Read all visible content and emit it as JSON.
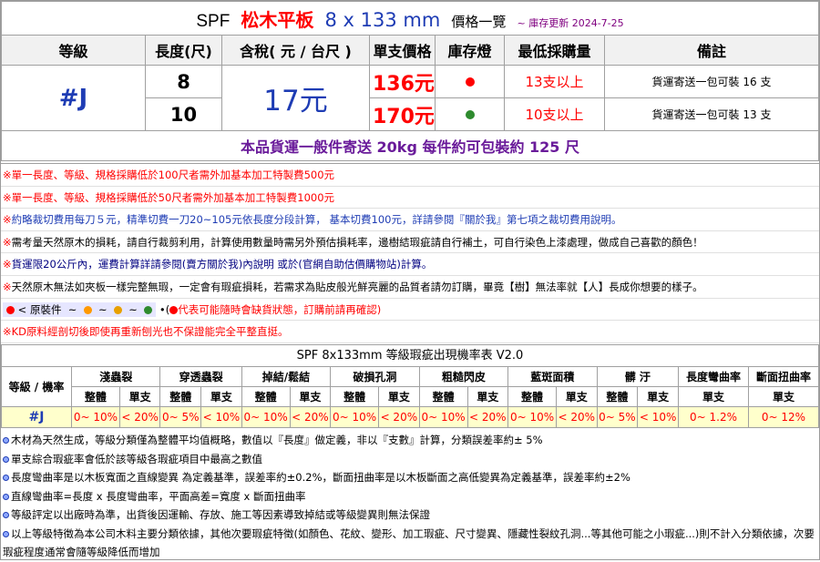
{
  "title": {
    "brand": "SPF",
    "product": "松木平板",
    "spec": "8 x 133 mm",
    "label": "價格一覽",
    "updated": "~ 庫存更新 2024-7-25"
  },
  "headers": {
    "grade": "等級",
    "length": "長度(尺)",
    "tax_price": "含稅( 元 / 台尺 )",
    "unit_price": "單支價格",
    "stock": "庫存燈",
    "min_qty": "最低採購量",
    "remark": "備註"
  },
  "grade": "#J",
  "price_per_ft": "17元",
  "rows": [
    {
      "length": "8",
      "unit_price": "136元",
      "stock_color": "#ff0000",
      "min_qty": "13支以上",
      "remark": "貨運寄送一包可裝 16 支"
    },
    {
      "length": "10",
      "unit_price": "170元",
      "stock_color": "#2e8b2e",
      "min_qty": "10支以上",
      "remark": "貨運寄送一包可裝 13 支"
    }
  ],
  "shipping": "本品貨運一般件寄送 20kg 每件約可包裝約 125 尺",
  "notes": [
    {
      "mark": "※",
      "text": "單一長度、等級、規格採購低於100尺者需外加基本加工特製費500元",
      "color": "red"
    },
    {
      "mark": "※",
      "text": "單一長度、等級、規格採購低於50尺者需外加基本加工特製費1000元",
      "color": "red"
    },
    {
      "mark": "※",
      "text": "約略裁切費用每刀５元，精準切費一刀20~105元依長度分段計算， 基本切費100元，詳請參閱『關於我』第七項之裁切費用說明。",
      "color": "blue"
    },
    {
      "mark": "※",
      "text": "需考量天然原木的損耗，請自行裁剪利用，計算使用數量時需另外預估損耗率，邊樹結瑕疵請自行補土，可自行染色上漆處理，做成自己喜歡的顏色！",
      "color": "black"
    },
    {
      "mark": "※",
      "text": "貨運限20公斤內，運費計算詳請參閱(賣方關於我)內說明 或於(官網自助估價購物站)計算。",
      "color": "navy"
    },
    {
      "mark": "※",
      "text": "天然原木無法如夾板一樣完整無瑕，一定會有瑕疵損耗，若需求為貼皮般光鮮亮麗的品質者請勿訂購，畢竟【樹】無法率就【人】長成你想要的樣子。",
      "color": "black"
    },
    {
      "mark": "※",
      "text": "KD原料經剖切後即使再重新刨光也不保證能完全平整直挺。",
      "color": "red"
    }
  ],
  "legend": {
    "label": "< 原裝件",
    "tilde": "~",
    "dots": [
      "#ff0000",
      "#ff9900",
      "#e8a000",
      "#2e8b2e"
    ],
    "dot_mid": "•",
    "paren_open": "(",
    "warning": "代表可能隨時會缺貨狀態，訂購前請再確認)"
  },
  "defect_table": {
    "title": "SPF 8x133mm 等級瑕疵出現機率表 V2.0",
    "grade_label": "等級 / 機率",
    "groups": [
      "淺蟲裂",
      "穿透蟲裂",
      "掉結/鬆結",
      "破損孔洞",
      "粗糙閃皮",
      "藍斑面積",
      "髒 汙",
      "長度彎曲率",
      "斷面扭曲率"
    ],
    "sub_whole": "整體",
    "sub_single": "單支",
    "grade": "#J",
    "values": [
      "0~ 10%",
      "< 20%",
      "0~ 5%",
      "< 10%",
      "0~ 10%",
      "< 20%",
      "0~ 10%",
      "< 20%",
      "0~ 10%",
      "< 20%",
      "0~ 10%",
      "< 20%",
      "0~ 5%",
      "< 10%",
      "0~ 1.2%",
      "0~ 12%"
    ]
  },
  "bottom_notes": [
    "木材為天然生成，等級分類僅為整體平均值概略，數值以『長度』做定義，非以『支數』計算，分類誤差率約± 5%",
    "單支綜合瑕疵率會低於該等級各瑕疵項目中最高之數值",
    "長度彎曲率是以木板寬面之直線變異 為定義基準，誤差率約±0.2%，斷面扭曲率是以木板斷面之高低變異為定義基準，誤差率約±2%",
    "直線彎曲率=長度 x 長度彎曲率，平面高差=寬度 x 斷面扭曲率",
    "等級評定以出廠時為準，出貨後因運輸、存放、施工等因素導致掉結或等級變異則無法保證",
    "以上等級特徵為本公司木料主要分類依據，其他次要瑕疵特徵(如顏色、花紋、變形、加工瑕疵、尺寸變異、隱藏性裂紋孔洞...等其他可能之小瑕疵...)則不計入分類依據，次要瑕疵程度通常會隨等級降低而增加"
  ]
}
